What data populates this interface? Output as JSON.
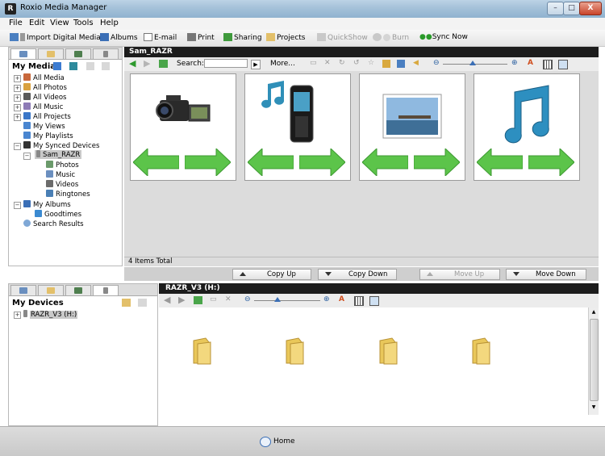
{
  "window": {
    "title": "Roxio Media Manager",
    "min": "–",
    "max": "□",
    "close": "X"
  },
  "menu": [
    "File",
    "Edit",
    "View",
    "Tools",
    "Help"
  ],
  "toolbar": {
    "import": "Import Digital Media",
    "albums": "Albums",
    "email": "E-mail",
    "print": "Print",
    "sharing": "Sharing",
    "projects": "Projects",
    "quickshow": "QuickShow",
    "burn": "Burn",
    "sync": "Sync Now"
  },
  "left": {
    "title": "My Media",
    "tree": [
      {
        "label": "All Media"
      },
      {
        "label": "All Photos"
      },
      {
        "label": "All Videos"
      },
      {
        "label": "All Music"
      },
      {
        "label": "All Projects"
      },
      {
        "label": "My Views"
      },
      {
        "label": "My Playlists"
      },
      {
        "label": "My Synced Devices"
      },
      {
        "label": "Sam_RAZR"
      },
      {
        "label": "Photos"
      },
      {
        "label": "Music"
      },
      {
        "label": "Videos"
      },
      {
        "label": "Ringtones"
      },
      {
        "label": "My Albums"
      },
      {
        "label": "Goodtimes"
      },
      {
        "label": "Search Results"
      }
    ]
  },
  "main": {
    "title": "Sam_RAZR",
    "search_label": "Search:",
    "search_value": "",
    "more": "More...",
    "total": "4 Items Total",
    "cards": [
      "video",
      "phone",
      "photo",
      "music"
    ]
  },
  "copybar": {
    "copy_up": "Copy Up",
    "copy_down": "Copy Down",
    "move_up": "Move Up",
    "move_down": "Move Down"
  },
  "devices": {
    "title": "My Devices",
    "item": "RAZR_V3 (H:)",
    "panel_title": "RAZR_V3 (H:)"
  },
  "status": {
    "home": "Home"
  },
  "colors": {
    "accent": "#1c1c1c",
    "arrow": "#5cc44a",
    "folder": "#e9c75a"
  }
}
